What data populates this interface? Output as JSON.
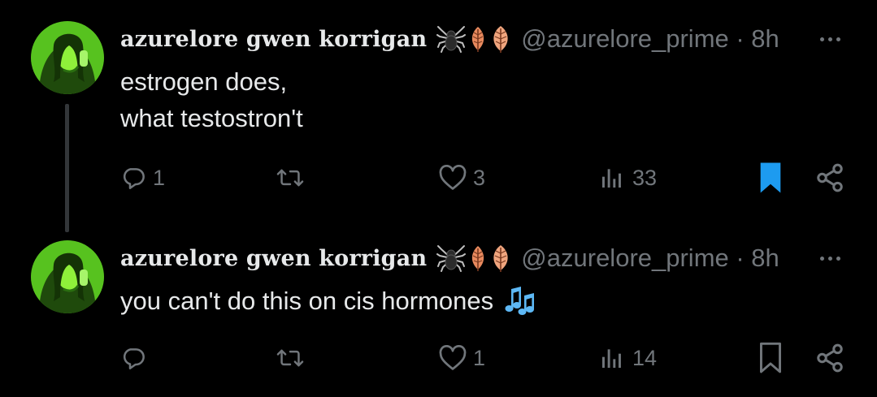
{
  "colors": {
    "background": "#000000",
    "primary_text": "#e7e9ea",
    "secondary_text": "#71767b",
    "bookmark_active": "#1d9bf0",
    "thread_line": "#333639",
    "avatar_green": "#6fdc2a"
  },
  "tweets": [
    {
      "display_name": "azurelore gwen korrigan",
      "name_emojis": [
        "spider-icon",
        "leaf-icon",
        "leaf-icon"
      ],
      "handle": "@azurelore_prime · 8h",
      "lines": [
        "estrogen does,",
        "what testostron't"
      ],
      "reply_count": "1",
      "repost_count": "",
      "like_count": "3",
      "view_count": "33",
      "bookmarked": true
    },
    {
      "display_name": "azurelore gwen korrigan",
      "name_emojis": [
        "spider-icon",
        "leaf-icon",
        "leaf-icon"
      ],
      "handle": "@azurelore_prime · 8h",
      "text": "you can't do this on cis hormones",
      "trailing_emoji": "music-notes-icon",
      "reply_count": "",
      "repost_count": "",
      "like_count": "1",
      "view_count": "14",
      "bookmarked": false
    }
  ]
}
